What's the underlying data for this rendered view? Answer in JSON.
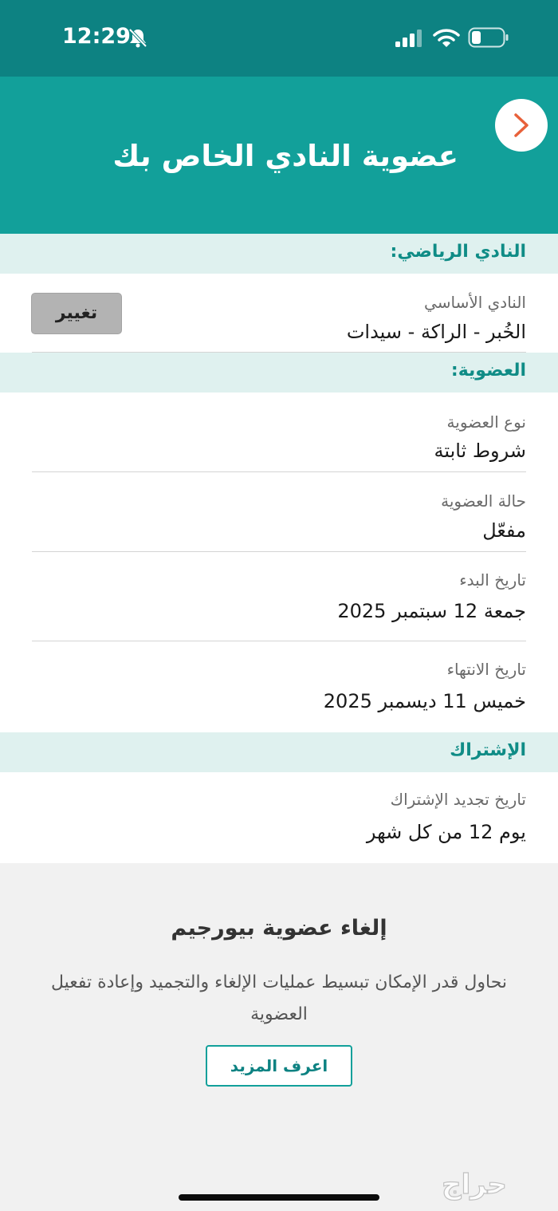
{
  "status_bar": {
    "time": "12:29",
    "icons": [
      "bell-slash-icon",
      "cellular-signal-icon",
      "wifi-icon",
      "battery-icon"
    ]
  },
  "header": {
    "title": "عضوية النادي الخاص بك",
    "back_icon": "chevron-right-icon"
  },
  "sections": {
    "club": {
      "title": "النادي الرياضي:",
      "home_club_label": "النادي الأساسي",
      "home_club_value": "الخُبر - الراكة - سيدات",
      "change_button": "تغيير"
    },
    "membership": {
      "title": "العضوية:",
      "type_label": "نوع العضوية",
      "type_value": "شروط ثابتة",
      "status_label": "حالة العضوية",
      "status_value": "مفعّل",
      "start_label": "تاريخ البدء",
      "start_value": "جمعة 12 سبتمبر 2025",
      "end_label": "تاريخ الانتهاء",
      "end_value": "خميس 11 ديسمبر 2025"
    },
    "subscription": {
      "title": "الإشتراك",
      "renewal_label": "تاريخ تجديد الإشتراك",
      "renewal_value": "يوم 12 من كل شهر"
    }
  },
  "cancel": {
    "title": "إلغاء عضوية بيورجيم",
    "description": "نحاول قدر الإمكان تبسيط عمليات الإلغاء والتجميد وإعادة تفعيل العضوية",
    "learn_more_button": "اعرف المزيد"
  },
  "watermark": "حراج",
  "colors": {
    "status_bar": "#0d8282",
    "header": "#12a09a",
    "section_bg": "#dff1ef",
    "section_text": "#0f8c86",
    "accent": "#e8613a"
  }
}
